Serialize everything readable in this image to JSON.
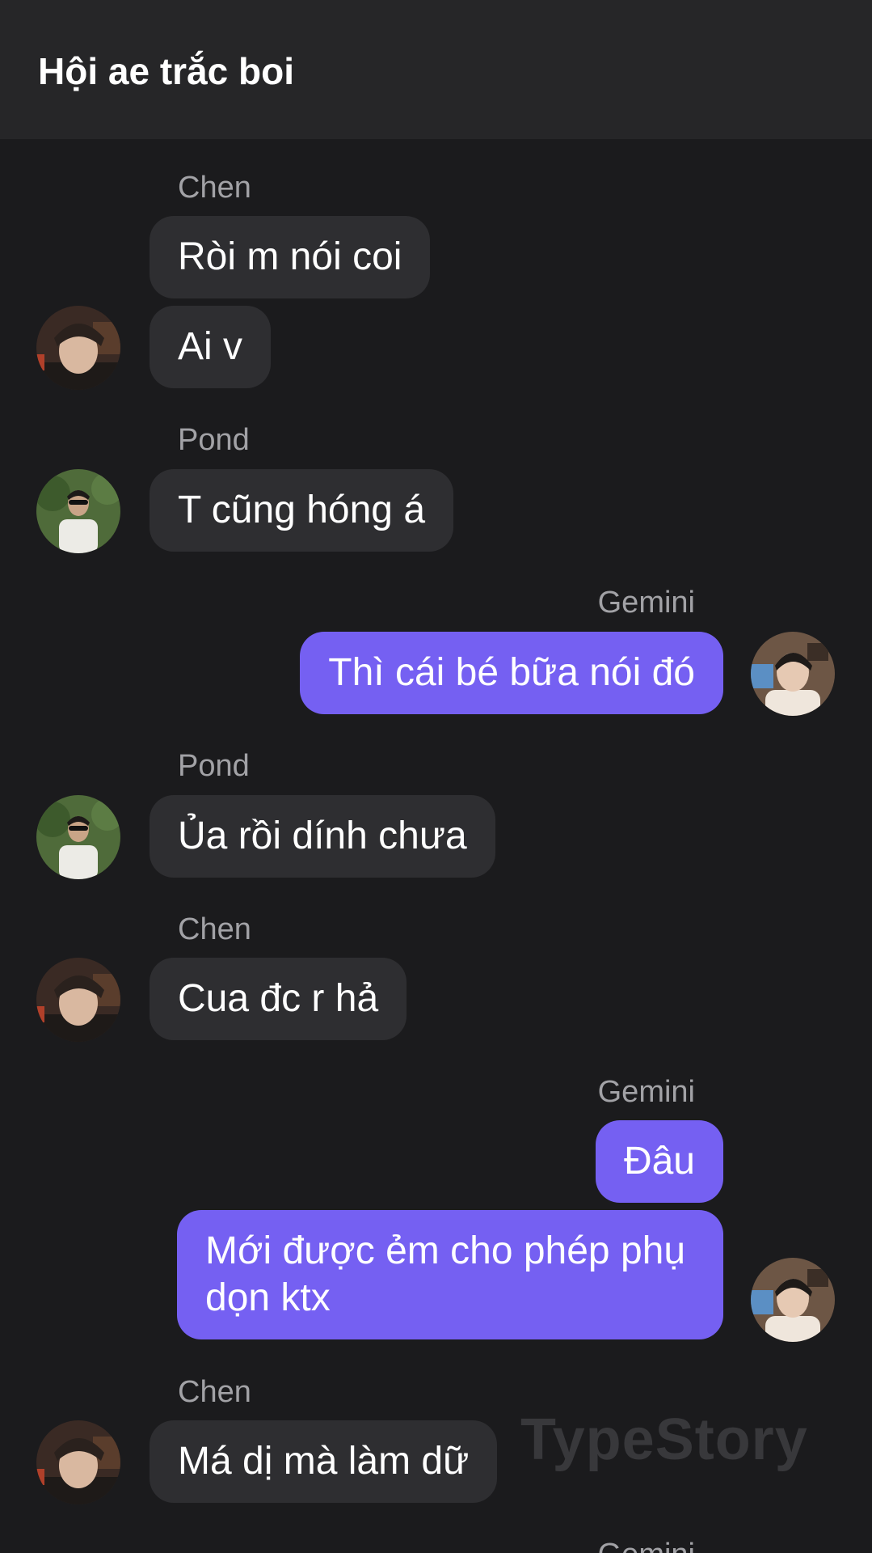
{
  "header": {
    "title": "Hội ae trắc boi"
  },
  "messages": [
    {
      "sender": "Chen",
      "texts": [
        "Ròi m nói coi",
        "Ai v"
      ],
      "side": "left"
    },
    {
      "sender": "Pond",
      "texts": [
        "T cũng hóng  á"
      ],
      "side": "left"
    },
    {
      "sender": "Gemini",
      "texts": [
        "Thì cái bé bữa nói đó"
      ],
      "side": "right"
    },
    {
      "sender": "Pond",
      "texts": [
        "Ủa rồi dính chưa"
      ],
      "side": "left"
    },
    {
      "sender": "Chen",
      "texts": [
        "Cua đc r hả"
      ],
      "side": "left"
    },
    {
      "sender": "Gemini",
      "texts": [
        "Đâu",
        "Mới được ẻm cho phép phụ dọn ktx"
      ],
      "side": "right"
    },
    {
      "sender": "Chen",
      "texts": [
        "Má dị mà làm dữ"
      ],
      "side": "left"
    },
    {
      "sender": "Gemini",
      "texts": [],
      "side": "right"
    }
  ],
  "watermark": "TypeStory",
  "colors": {
    "background": "#1b1b1d",
    "header": "#262628",
    "incoming_bubble": "#2e2e31",
    "outgoing_bubble": "#7560f2",
    "sender_name": "#a2a2a6"
  }
}
